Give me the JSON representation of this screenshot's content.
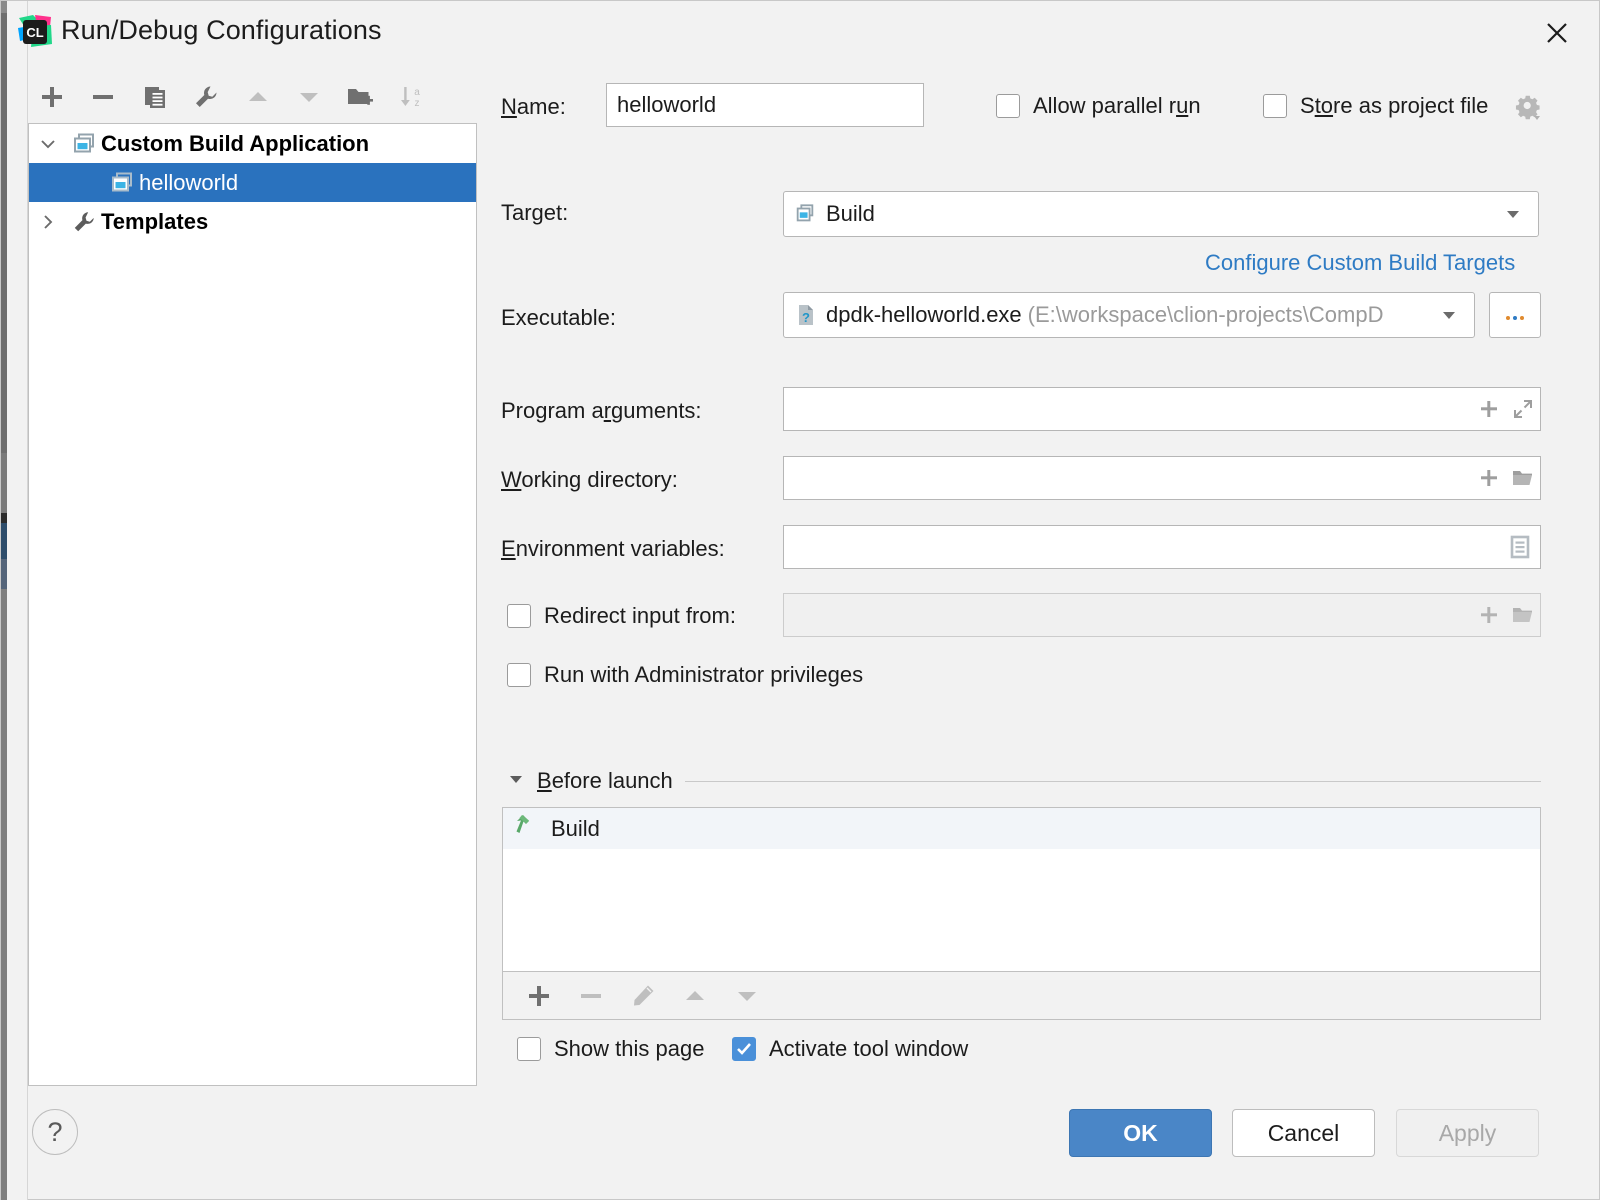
{
  "window": {
    "title": "Run/Debug Configurations",
    "logo_icon": "clion-logo-icon",
    "close_icon": "close-icon"
  },
  "left_toolbar": {
    "buttons": [
      {
        "name": "add-configuration-button",
        "icon": "plus-icon",
        "enabled": true
      },
      {
        "name": "remove-configuration-button",
        "icon": "minus-icon",
        "enabled": true
      },
      {
        "name": "copy-configuration-button",
        "icon": "copy-icon",
        "enabled": true
      },
      {
        "name": "edit-templates-button",
        "icon": "wrench-icon",
        "enabled": true
      },
      {
        "name": "move-up-button",
        "icon": "arrow-up-icon",
        "enabled": false
      },
      {
        "name": "move-down-button",
        "icon": "arrow-down-icon",
        "enabled": false
      },
      {
        "name": "new-folder-button",
        "icon": "folder-add-icon",
        "enabled": true
      },
      {
        "name": "sort-alphabetically-button",
        "icon": "sort-az-icon",
        "enabled": false
      }
    ]
  },
  "tree": {
    "items": [
      {
        "label": "Custom Build Application",
        "icon": "application-icon",
        "arrow": "chevron-down-icon",
        "level": 0,
        "selected": false
      },
      {
        "label": "helloworld",
        "icon": "application-icon",
        "arrow": "",
        "level": 1,
        "selected": true
      },
      {
        "label": "Templates",
        "icon": "wrench-icon",
        "arrow": "chevron-right-icon",
        "level": 0,
        "selected": false
      }
    ]
  },
  "form": {
    "name": {
      "label": "Name:",
      "label_mnemonic": "N",
      "value": "helloworld"
    },
    "allow_parallel_run": {
      "label": "Allow parallel run",
      "checked": false
    },
    "store_as_project_file": {
      "label": "Store as project file",
      "checked": false,
      "gear_icon": "gear-icon"
    },
    "target": {
      "label": "Target:",
      "value": "Build",
      "icon": "target-icon",
      "dropdown_icon": "chevron-down-icon"
    },
    "configure_link": {
      "label": "Configure Custom Build Targets"
    },
    "executable": {
      "label": "Executable:",
      "value": "dpdk-helloworld.exe",
      "path": "(E:\\workspace\\clion-projects\\CompD",
      "icon": "executable-unknown-icon",
      "dropdown_icon": "chevron-down-icon",
      "browse_label": "...",
      "browse_icon": "browse-ellipsis-icon"
    },
    "program_arguments": {
      "label": "Program arguments:",
      "label_mnemonic": "r",
      "value": "",
      "icons": [
        "insert-macro-icon",
        "expand-icon"
      ]
    },
    "working_directory": {
      "label": "Working directory:",
      "label_mnemonic": "W",
      "value": "",
      "icons": [
        "insert-macro-icon",
        "folder-icon"
      ]
    },
    "environment_variables": {
      "label": "Environment variables:",
      "label_mnemonic": "E",
      "value": "",
      "icons": [
        "edit-list-icon"
      ]
    },
    "redirect_input": {
      "label": "Redirect input from:",
      "checked": false,
      "value": "",
      "disabled": true,
      "icons": [
        "insert-macro-icon",
        "folder-icon"
      ]
    },
    "run_as_administrator": {
      "label": "Run with Administrator privileges",
      "checked": false
    }
  },
  "before_launch": {
    "title": "Before launch",
    "title_mnemonic": "B",
    "collapse_icon": "triangle-down-icon",
    "items": [
      {
        "label": "Build",
        "icon": "build-hammer-icon"
      }
    ],
    "toolbar": [
      {
        "name": "add-task-button",
        "icon": "plus-icon",
        "enabled": true
      },
      {
        "name": "remove-task-button",
        "icon": "minus-icon",
        "enabled": false
      },
      {
        "name": "edit-task-button",
        "icon": "pencil-icon",
        "enabled": false
      },
      {
        "name": "move-task-up-button",
        "icon": "arrow-up-icon",
        "enabled": false
      },
      {
        "name": "move-task-down-button",
        "icon": "arrow-down-icon",
        "enabled": false
      }
    ],
    "show_this_page": {
      "label": "Show this page",
      "checked": false
    },
    "activate_tool_window": {
      "label": "Activate tool window",
      "checked": true
    }
  },
  "footer": {
    "help_label": "?",
    "ok_label": "OK",
    "cancel_label": "Cancel",
    "apply_label": "Apply",
    "apply_enabled": false
  },
  "colors": {
    "accent_blue": "#4a86c7",
    "selection_blue": "#2a72be",
    "link_blue": "#2e7bc4",
    "checkbox_blue": "#4a90d9",
    "dialog_bg": "#f2f2f2"
  }
}
